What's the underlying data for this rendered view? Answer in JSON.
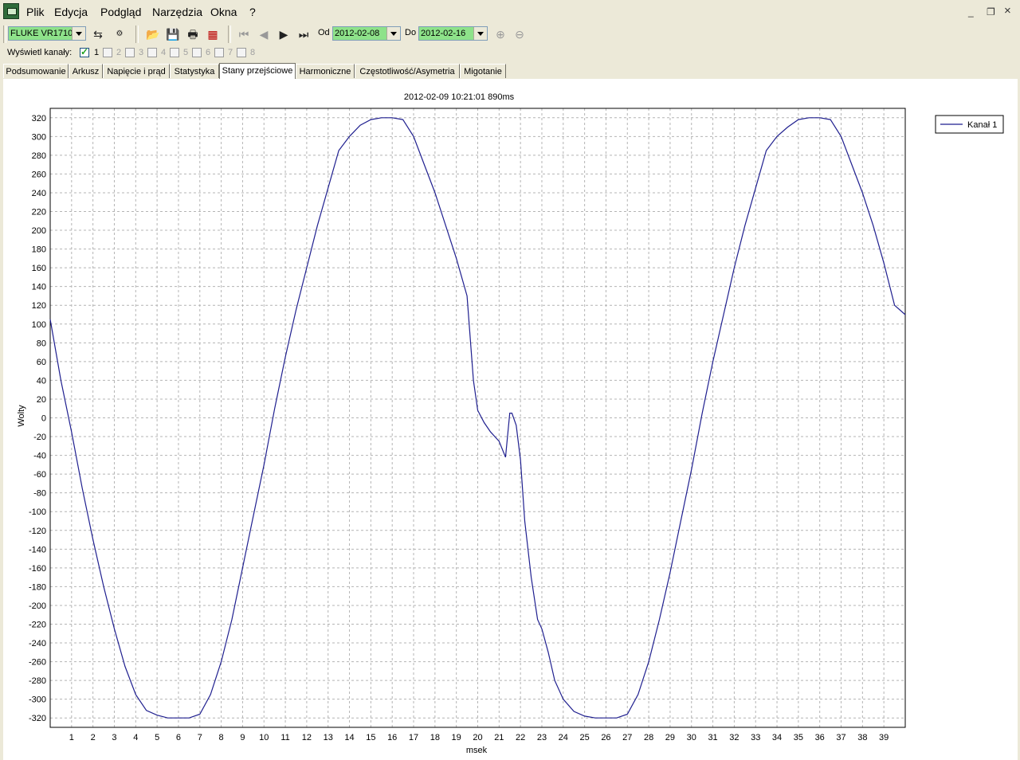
{
  "menu": [
    "Plik",
    "Edycja",
    "Podgląd",
    "Narzędzia",
    "Okna",
    "?"
  ],
  "window_buttons": {
    "minimize": "_",
    "restore": "❐",
    "close": "×"
  },
  "toolbar": {
    "device": "FLUKE VR1710",
    "from_label": "Od",
    "from_date": "2012-02-08",
    "to_label": "Do",
    "to_date": "2012-02-16"
  },
  "channels": {
    "label": "Wyświetl kanały:",
    "items": [
      {
        "label": "1",
        "checked": true,
        "enabled": true
      },
      {
        "label": "2",
        "checked": false,
        "enabled": false
      },
      {
        "label": "3",
        "checked": false,
        "enabled": false
      },
      {
        "label": "4",
        "checked": false,
        "enabled": false
      },
      {
        "label": "5",
        "checked": false,
        "enabled": false
      },
      {
        "label": "6",
        "checked": false,
        "enabled": false
      },
      {
        "label": "7",
        "checked": false,
        "enabled": false
      },
      {
        "label": "8",
        "checked": false,
        "enabled": false
      }
    ]
  },
  "tabs": [
    {
      "label": "Podsumowanie",
      "active": false
    },
    {
      "label": "Arkusz",
      "active": false
    },
    {
      "label": "Napięcie i prąd",
      "active": false
    },
    {
      "label": "Statystyka",
      "active": false
    },
    {
      "label": "Stany przejściowe",
      "active": true
    },
    {
      "label": "Harmoniczne",
      "active": false
    },
    {
      "label": "Częstotliwość/Asymetria",
      "active": false
    },
    {
      "label": "Migotanie",
      "active": false
    }
  ],
  "colors": {
    "series": "#1f1f8f",
    "grid": "#b4b4b4",
    "accent_green": "#8ee28a"
  },
  "chart_data": {
    "type": "line",
    "title": "2012-02-09 10:21:01 890ms",
    "xlabel": "msek",
    "ylabel": "Wolty",
    "xlim": [
      0,
      40
    ],
    "ylim": [
      -330,
      330
    ],
    "x_ticks": [
      1,
      2,
      3,
      4,
      5,
      6,
      7,
      8,
      9,
      10,
      11,
      12,
      13,
      14,
      15,
      16,
      17,
      18,
      19,
      20,
      21,
      22,
      23,
      24,
      25,
      26,
      27,
      28,
      29,
      30,
      31,
      32,
      33,
      34,
      35,
      36,
      37,
      38,
      39
    ],
    "y_ticks": [
      320,
      300,
      280,
      260,
      240,
      220,
      200,
      180,
      160,
      140,
      120,
      100,
      80,
      60,
      40,
      20,
      0,
      -20,
      -40,
      -60,
      -80,
      -100,
      -120,
      -140,
      -160,
      -180,
      -200,
      -220,
      -240,
      -260,
      -280,
      -300,
      -320
    ],
    "grid": true,
    "legend": "top-right",
    "series": [
      {
        "name": "Kanał 1",
        "x": [
          0,
          0.5,
          1,
          1.5,
          2,
          2.5,
          3,
          3.5,
          4,
          4.5,
          5,
          5.5,
          6,
          6.5,
          7,
          7.5,
          8,
          8.5,
          9,
          9.5,
          10,
          10.5,
          11,
          11.5,
          12,
          12.5,
          13,
          13.5,
          14,
          14.5,
          15,
          15.5,
          16,
          16.5,
          17,
          17.5,
          18,
          18.5,
          19,
          19.5,
          19.8,
          20,
          20.3,
          20.6,
          21,
          21.3,
          21.5,
          21.6,
          21.8,
          22,
          22.2,
          22.5,
          22.8,
          23,
          23.3,
          23.6,
          24,
          24.5,
          25,
          25.5,
          26,
          26.5,
          27,
          27.5,
          28,
          28.5,
          29,
          29.5,
          30,
          30.5,
          31,
          31.5,
          32,
          32.5,
          33,
          33.5,
          34,
          34.5,
          35,
          35.5,
          36,
          36.5,
          37,
          37.5,
          38,
          38.5,
          39,
          39.5,
          40
        ],
        "y": [
          105,
          40,
          -15,
          -75,
          -130,
          -180,
          -225,
          -265,
          -295,
          -312,
          -317,
          -320,
          -320,
          -320,
          -316,
          -295,
          -260,
          -215,
          -160,
          -105,
          -50,
          10,
          65,
          115,
          160,
          205,
          245,
          285,
          300,
          312,
          318,
          320,
          320,
          318,
          300,
          270,
          240,
          205,
          170,
          130,
          40,
          8,
          -5,
          -15,
          -25,
          -42,
          5,
          5,
          -8,
          -45,
          -110,
          -170,
          -215,
          -225,
          -250,
          -280,
          -300,
          -313,
          -318,
          -320,
          -320,
          -320,
          -316,
          -295,
          -260,
          -215,
          -165,
          -110,
          -55,
          5,
          60,
          110,
          160,
          205,
          245,
          285,
          300,
          310,
          318,
          320,
          320,
          318,
          300,
          270,
          240,
          205,
          165,
          120,
          110
        ]
      }
    ]
  }
}
